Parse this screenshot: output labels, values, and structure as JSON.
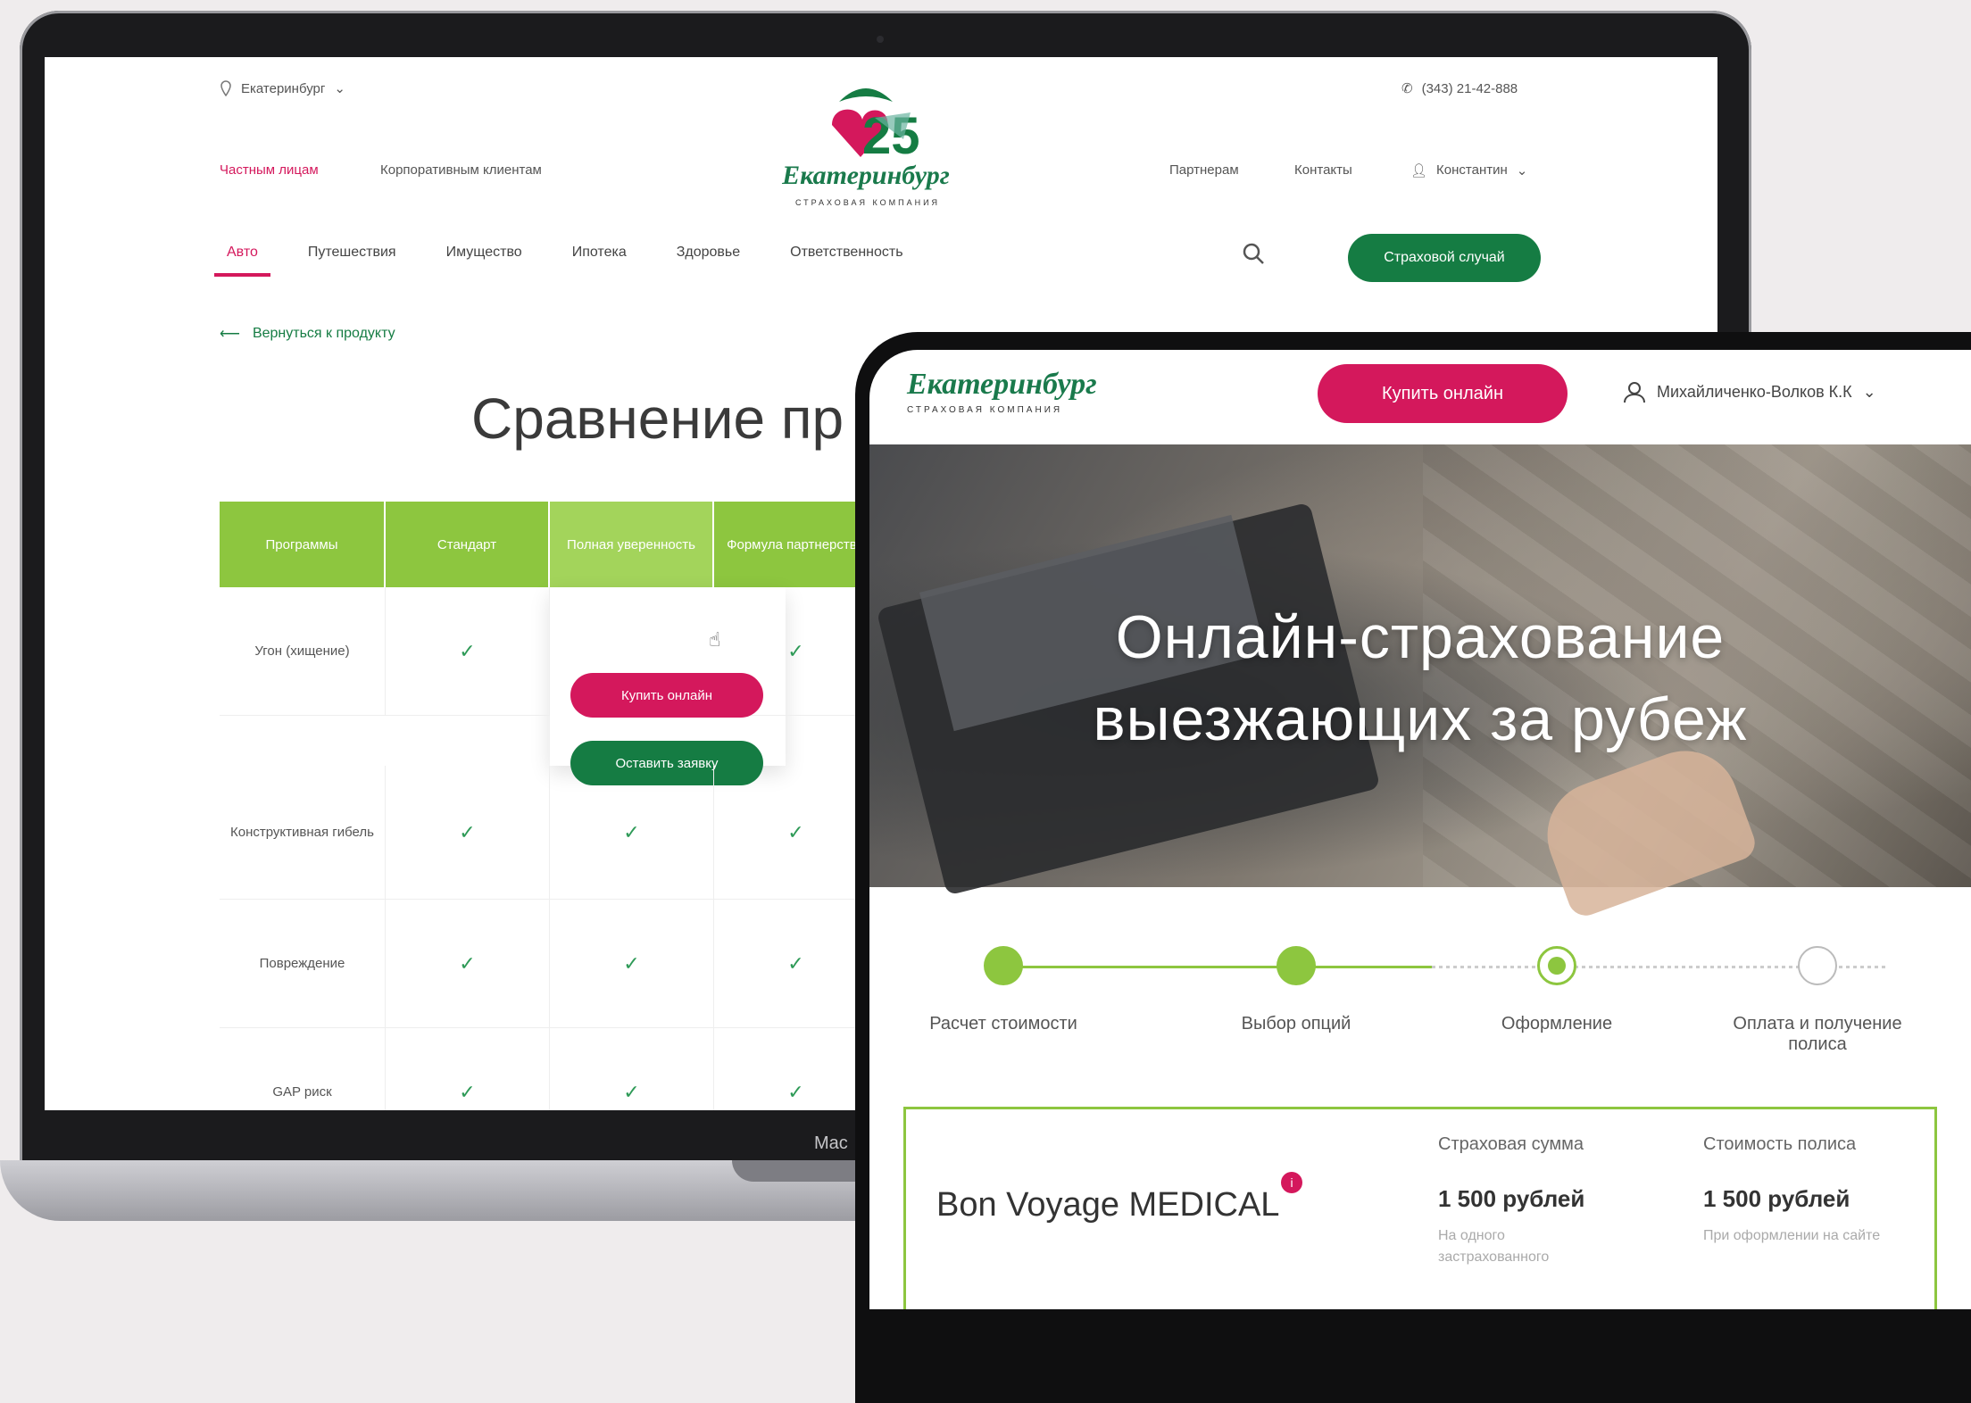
{
  "laptop": {
    "chin_label": "Mac",
    "site": {
      "city": "Екатеринбург",
      "phone": "(343) 21-42-888",
      "logo": {
        "name": "Екатеринбург",
        "subtitle": "СТРАХОВАЯ КОМПАНИЯ",
        "anniversary": "25"
      },
      "segments": [
        {
          "label": "Частным лицам",
          "active": true
        },
        {
          "label": "Корпоративным клиентам",
          "active": false
        }
      ],
      "right_links": [
        "Партнерам",
        "Контакты"
      ],
      "user": "Константин",
      "nav": [
        {
          "label": "Авто",
          "active": true
        },
        {
          "label": "Путешествия",
          "active": false
        },
        {
          "label": "Имущество",
          "active": false
        },
        {
          "label": "Ипотека",
          "active": false
        },
        {
          "label": "Здоровье",
          "active": false
        },
        {
          "label": "Ответственность",
          "active": false
        }
      ],
      "claim_button": "Страховой случай",
      "back_link": "Вернуться к продукту",
      "page_title": "Сравнение пр",
      "table": {
        "headers": [
          "Программы",
          "Стандарт",
          "Полная уверенность",
          "Формула партнерства"
        ],
        "rows": [
          {
            "label": "Угон (хищение)",
            "checks": [
              true,
              null,
              true
            ]
          },
          {
            "label": "Конструктивная гибель",
            "checks": [
              true,
              true,
              true
            ]
          },
          {
            "label": "Повреждение",
            "checks": [
              true,
              true,
              true
            ]
          },
          {
            "label": "GAP риск",
            "checks": [
              true,
              true,
              true
            ]
          }
        ],
        "buy_button": "Купить онлайн",
        "lead_button": "Оставить заявку",
        "check_symbol": "✓"
      }
    }
  },
  "tablet": {
    "logo": {
      "name": "Екатеринбург",
      "subtitle": "СТРАХОВАЯ КОМПАНИЯ"
    },
    "buy_button": "Купить онлайн",
    "user": "Михайличенко-Волков К.К",
    "hero_title_line1": "Онлайн-страхование",
    "hero_title_line2": "выезжающих за рубеж",
    "steps": [
      {
        "label": "Расчет стоимости",
        "status": "done"
      },
      {
        "label": "Выбор опций",
        "status": "done"
      },
      {
        "label": "Оформление",
        "status": "current"
      },
      {
        "label": "Оплата и получение полиса",
        "status": "todo"
      }
    ],
    "card": {
      "product": "Bon Voyage MEDICAL",
      "info_icon": "i",
      "sum_label": "Страховая сумма",
      "sum_value": "1 500 рублей",
      "sum_note": "На одного застрахованного",
      "price_label": "Стоимость полиса",
      "price_value": "1 500 рублей",
      "price_note": "При оформлении на сайте"
    }
  },
  "colors": {
    "brand_green": "#157c43",
    "brand_pink": "#d4185c",
    "accent_green": "#8dc63f"
  }
}
